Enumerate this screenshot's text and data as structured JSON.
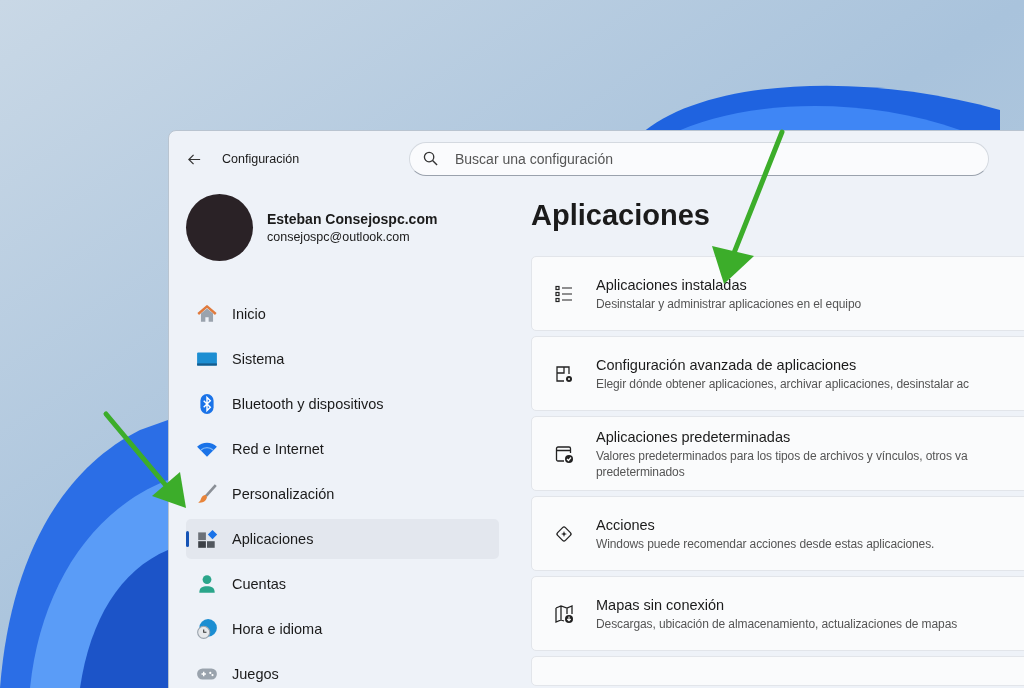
{
  "window": {
    "title": "Configuración"
  },
  "search": {
    "placeholder": "Buscar una configuración"
  },
  "profile": {
    "name": "Esteban Consejospc.com",
    "email": "consejospc@outlook.com"
  },
  "sidebar": {
    "items": [
      {
        "label": "Inicio",
        "selected": false
      },
      {
        "label": "Sistema",
        "selected": false
      },
      {
        "label": "Bluetooth y dispositivos",
        "selected": false
      },
      {
        "label": "Red e Internet",
        "selected": false
      },
      {
        "label": "Personalización",
        "selected": false
      },
      {
        "label": "Aplicaciones",
        "selected": true
      },
      {
        "label": "Cuentas",
        "selected": false
      },
      {
        "label": "Hora e idioma",
        "selected": false
      },
      {
        "label": "Juegos",
        "selected": false
      }
    ]
  },
  "page": {
    "title": "Aplicaciones",
    "cards": [
      {
        "title": "Aplicaciones instaladas",
        "description": [
          "Desinstalar y administrar aplicaciones en el equipo"
        ]
      },
      {
        "title": "Configuración avanzada de aplicaciones",
        "description": [
          "Elegir dónde obtener aplicaciones, archivar aplicaciones, desinstalar ac"
        ]
      },
      {
        "title": "Aplicaciones predeterminadas",
        "description": [
          "Valores predeterminados para los tipos de archivos y vínculos, otros va",
          "predeterminados"
        ]
      },
      {
        "title": "Acciones",
        "description": [
          "Windows puede recomendar acciones desde estas aplicaciones."
        ]
      },
      {
        "title": "Mapas sin conexión",
        "description": [
          "Descargas, ubicación de almacenamiento, actualizaciones de mapas"
        ]
      }
    ]
  }
}
